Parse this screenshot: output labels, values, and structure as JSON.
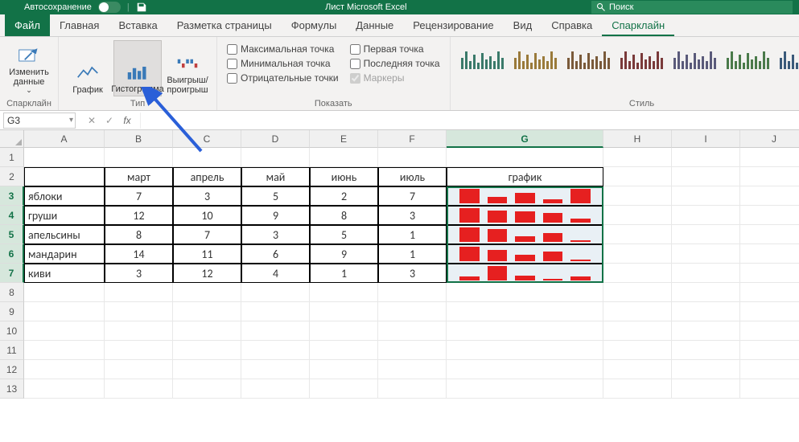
{
  "titlebar": {
    "autosave_label": "Автосохранение",
    "title": "Лист Microsoft Excel",
    "search_placeholder": "Поиск"
  },
  "tabs": {
    "file": "Файл",
    "home": "Главная",
    "insert": "Вставка",
    "layout": "Разметка страницы",
    "formulas": "Формулы",
    "data": "Данные",
    "review": "Рецензирование",
    "view": "Вид",
    "help": "Справка",
    "sparkline": "Спарклайн"
  },
  "ribbon": {
    "edit_data": "Изменить данные",
    "edit_data_arrow": "⌄",
    "group_sparkline": "Спарклайн",
    "line": "График",
    "column": "Гистограмма",
    "winloss": "Выигрыш/проигрыш",
    "group_type": "Тип",
    "high_point": "Максимальная точка",
    "low_point": "Минимальная точка",
    "neg_points": "Отрицательные точки",
    "first_point": "Первая точка",
    "last_point": "Последняя точка",
    "markers": "Маркеры",
    "group_show": "Показать",
    "group_style": "Стиль",
    "style_colors": [
      "#3a7a6a",
      "#9a7a3a",
      "#7a5a3a",
      "#7a3a3a",
      "#5a5a7a",
      "#4a7a4a",
      "#3a5a7a"
    ]
  },
  "namebox": "G3",
  "columns": [
    "A",
    "B",
    "C",
    "D",
    "E",
    "F",
    "G",
    "H",
    "I",
    "J"
  ],
  "row_headers": [
    "1",
    "2",
    "3",
    "4",
    "5",
    "6",
    "7",
    "8",
    "9",
    "10",
    "11",
    "12",
    "13"
  ],
  "table": {
    "hdr": {
      "b": "март",
      "c": "апрель",
      "d": "май",
      "e": "июнь",
      "f": "июль",
      "g": "график"
    },
    "rows": [
      {
        "a": "яблоки",
        "b": "7",
        "c": "3",
        "d": "5",
        "e": "2",
        "f": "7"
      },
      {
        "a": "груши",
        "b": "12",
        "c": "10",
        "d": "9",
        "e": "8",
        "f": "3"
      },
      {
        "a": "апельсины",
        "b": "8",
        "c": "7",
        "d": "3",
        "e": "5",
        "f": "1"
      },
      {
        "a": "мандарин",
        "b": "14",
        "c": "11",
        "d": "6",
        "e": "9",
        "f": "1"
      },
      {
        "a": "киви",
        "b": "3",
        "c": "12",
        "d": "4",
        "e": "1",
        "f": "3"
      }
    ]
  },
  "chart_data": {
    "type": "bar",
    "note": "Column sparklines in G3:G7, one per row, values from columns март–июль",
    "categories": [
      "март",
      "апрель",
      "май",
      "июнь",
      "июль"
    ],
    "series": [
      {
        "name": "яблоки",
        "values": [
          7,
          3,
          5,
          2,
          7
        ]
      },
      {
        "name": "груши",
        "values": [
          12,
          10,
          9,
          8,
          3
        ]
      },
      {
        "name": "апельсины",
        "values": [
          8,
          7,
          3,
          5,
          1
        ]
      },
      {
        "name": "мандарин",
        "values": [
          14,
          11,
          6,
          9,
          1
        ]
      },
      {
        "name": "киви",
        "values": [
          3,
          12,
          4,
          1,
          3
        ]
      }
    ],
    "fill_color": "#e62020"
  }
}
